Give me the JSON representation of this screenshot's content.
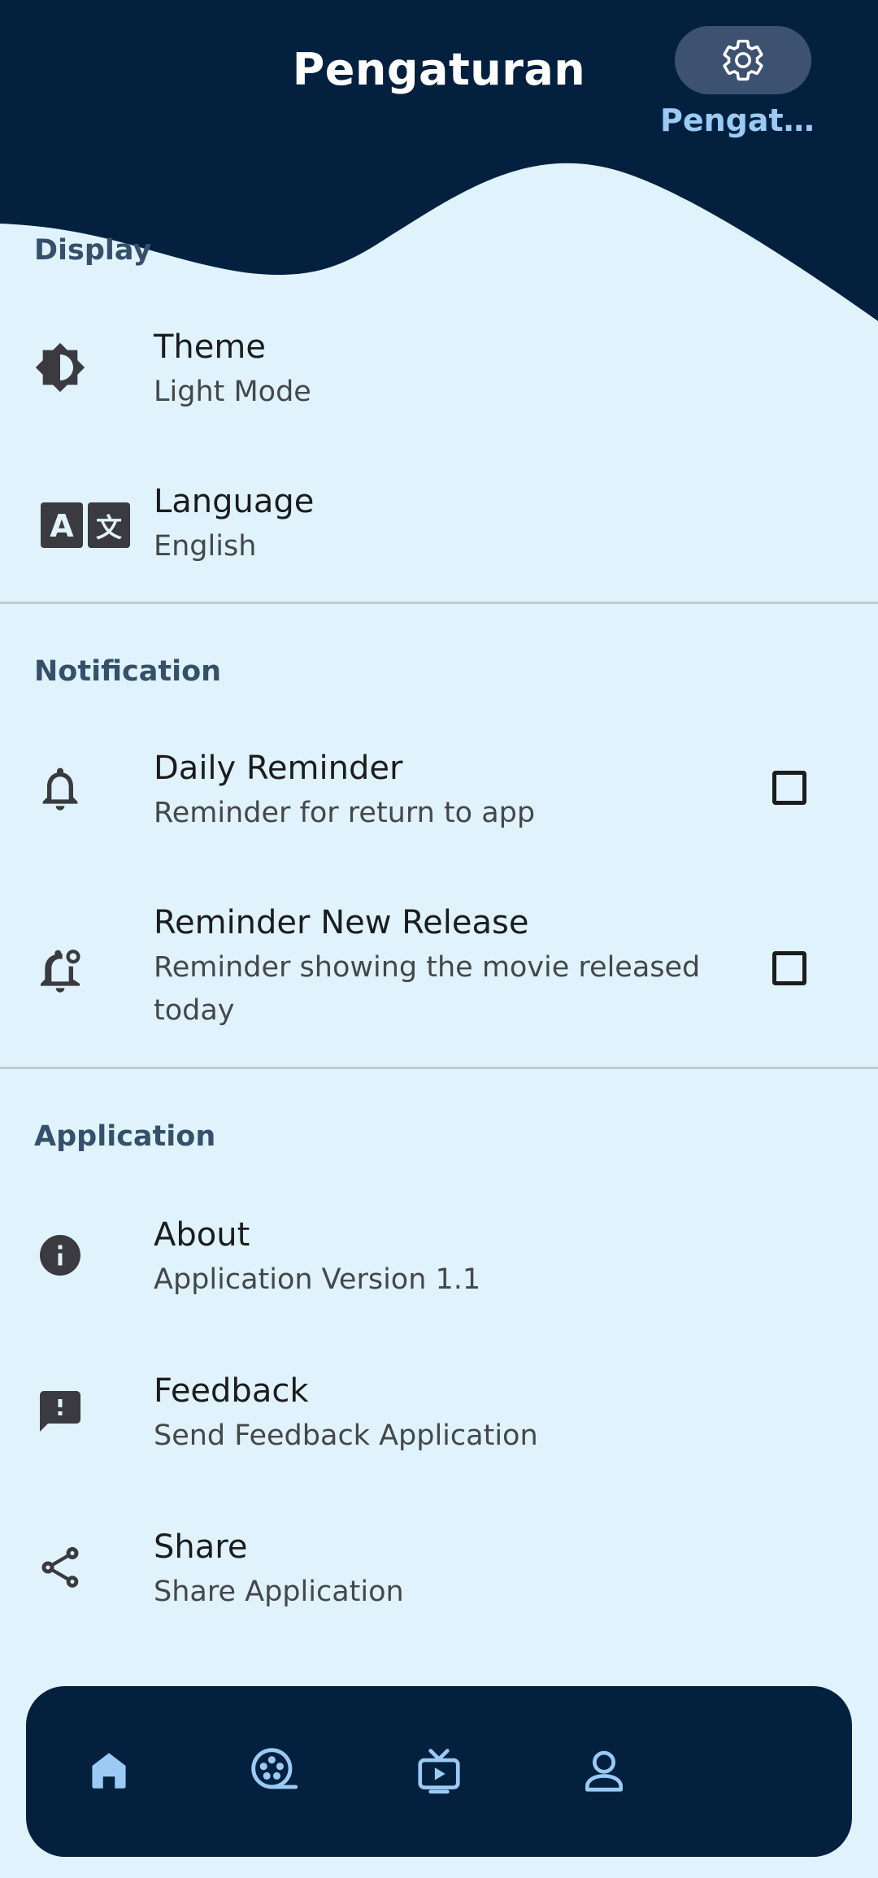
{
  "header": {
    "title": "Pengaturan"
  },
  "sections": {
    "display": {
      "label": "Display",
      "theme": {
        "title": "Theme",
        "subtitle": "Light Mode",
        "icon": "brightness-icon"
      },
      "language": {
        "title": "Language",
        "subtitle": "English",
        "icon": "translate-icon"
      }
    },
    "notification": {
      "label": "Notification",
      "daily_reminder": {
        "title": "Daily Reminder",
        "subtitle": "Reminder for return to app",
        "checked": false,
        "icon": "bell-icon"
      },
      "new_release": {
        "title": "Reminder New Release",
        "subtitle": "Reminder showing the movie released today",
        "checked": false,
        "icon": "bell-badge-icon"
      }
    },
    "application": {
      "label": "Application",
      "about": {
        "title": "About",
        "subtitle": "Application Version 1.1",
        "icon": "info-icon"
      },
      "feedback": {
        "title": "Feedback",
        "subtitle": "Send Feedback Application",
        "icon": "feedback-icon"
      },
      "share": {
        "title": "Share",
        "subtitle": "Share Application",
        "icon": "share-icon"
      }
    }
  },
  "bottom_nav": {
    "items": [
      {
        "icon": "home-icon"
      },
      {
        "icon": "film-reel-icon"
      },
      {
        "icon": "tv-icon"
      },
      {
        "icon": "person-icon"
      },
      {
        "icon": "gear-icon",
        "label": "Pengatur...",
        "active": true
      }
    ]
  },
  "colors": {
    "header": "#03213F",
    "background": "#E0F3FC",
    "nav_accent": "#9BCBF5",
    "section_label": "#35506B"
  }
}
